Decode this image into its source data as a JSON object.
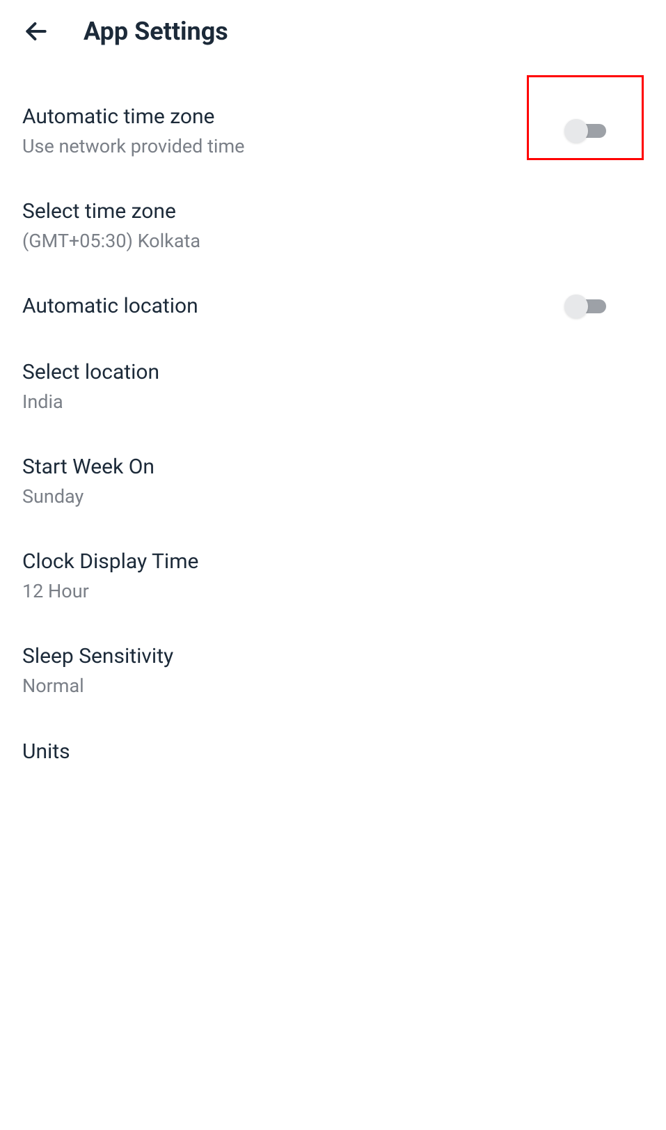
{
  "header": {
    "title": "App Settings"
  },
  "settings": {
    "autoTimezone": {
      "title": "Automatic time zone",
      "subtitle": "Use network provided time",
      "enabled": false,
      "highlighted": true
    },
    "selectTimezone": {
      "title": "Select time zone",
      "subtitle": "(GMT+05:30) Kolkata"
    },
    "autoLocation": {
      "title": "Automatic location",
      "enabled": false
    },
    "selectLocation": {
      "title": "Select location",
      "subtitle": "India"
    },
    "startWeek": {
      "title": "Start Week On",
      "subtitle": "Sunday"
    },
    "clockDisplay": {
      "title": "Clock Display Time",
      "subtitle": "12 Hour"
    },
    "sleepSensitivity": {
      "title": "Sleep Sensitivity",
      "subtitle": "Normal"
    },
    "units": {
      "title": "Units"
    }
  }
}
